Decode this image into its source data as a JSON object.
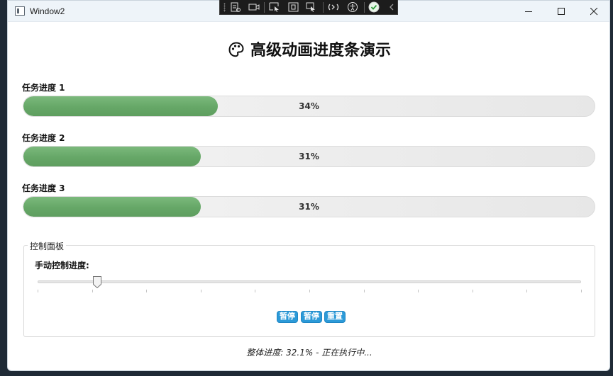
{
  "window": {
    "title": "Window2"
  },
  "page": {
    "heading": "高级动画进度条演示"
  },
  "tasks": [
    {
      "label": "任务进度 1",
      "percent": 34,
      "percent_text": "34%"
    },
    {
      "label": "任务进度 2",
      "percent": 31,
      "percent_text": "31%"
    },
    {
      "label": "任务进度 3",
      "percent": 31,
      "percent_text": "31%"
    }
  ],
  "control_panel": {
    "title": "控制面板",
    "manual_label": "手动控制进度:",
    "slider_value": 11,
    "slider_max": 100,
    "buttons": [
      {
        "label": "暂停"
      },
      {
        "label": "暂停"
      },
      {
        "label": "重置"
      }
    ]
  },
  "status": {
    "text": "整体进度: 32.1% - 正在执行中..."
  },
  "colors": {
    "progress_fill": "#66a767",
    "button_bg": "#2c9ad8",
    "titlebar_bg": "#eef4f9"
  }
}
